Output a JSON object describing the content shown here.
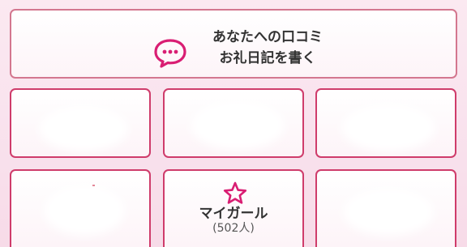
{
  "review_button": {
    "line1": "あなたへの口コミ",
    "line2": "お礼日記を書く",
    "icon": "chat-bubble-icon"
  },
  "mygirl": {
    "title": "マイガール",
    "count": "(502人)",
    "icon": "star-icon"
  },
  "colors": {
    "accent": "#cf3c6b",
    "background": "#fbe9f1"
  }
}
